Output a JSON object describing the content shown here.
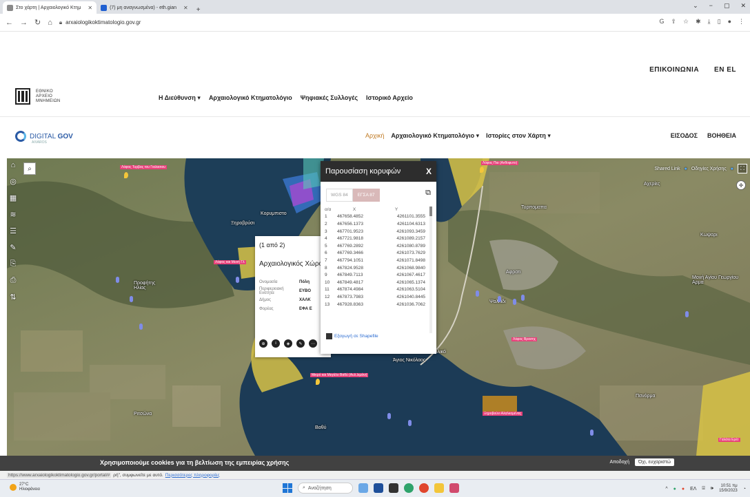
{
  "browser": {
    "tabs": [
      {
        "title": "Στο χάρτη | Αρχαιολογικό Κτημ",
        "active": true,
        "favicon_color": "#8a8a8a"
      },
      {
        "title": "(7) μη αναγνωσμένα) - eth.gian",
        "active": false,
        "favicon_color": "#1f5fd1"
      }
    ],
    "new_tab": "+",
    "url": "arxaiologikoktimatologio.gov.gr",
    "window_controls": [
      "⌄",
      "−",
      "▢",
      "✕"
    ]
  },
  "site": {
    "top_links": [
      "ΕΠΙΚΟΙΝΩΝΙΑ",
      "EN EL"
    ],
    "logo_text": [
      "ΕΘΝΙΚΟ",
      "ΑΡΧΕΙΟ",
      "ΜΝΗΜΕΙΩΝ"
    ],
    "main_nav": [
      "Η Διεύθυνση ▾",
      "Αρχαιολογικό Κτηματολόγιο",
      "Ψηφιακές Συλλογές",
      "Ιστορικό Αρχείο"
    ],
    "dg_logo": {
      "prefix": "DIGITAL ",
      "bold": "GOV",
      "sub": "AIVAROS"
    },
    "sub_nav": {
      "home": "Αρχική",
      "items": [
        "Αρχαιολογικό Κτηματολόγιο ▾",
        "Ιστορίες στον Χάρτη ▾"
      ]
    },
    "login_links": [
      "ΕΙΣΟΔΟΣ",
      "ΒΟΗΘΕΙΑ"
    ]
  },
  "map": {
    "right_controls": {
      "shared_link": "Shared Link",
      "guide": "Οδηγίες Χρήσης"
    },
    "labels": [
      {
        "text": "Κορυμπιστο"
      },
      {
        "text": "Ξηροβρύσι"
      },
      {
        "text": "Προφήτης Ηλίας"
      },
      {
        "text": "Τυρπομαπα"
      },
      {
        "text": "Κωψαρι"
      },
      {
        "text": "Αφρατι"
      },
      {
        "text": "Ψαλλίδι"
      },
      {
        "text": "Βασιλικό"
      },
      {
        "text": "Άγιος Νικόλαος"
      },
      {
        "text": "Μονή Αγίου Γεωργίου Αρμα"
      },
      {
        "text": "Πανόρμα"
      },
      {
        "text": "Ριτσώνα"
      },
      {
        "text": "Βαθύ"
      },
      {
        "text": "Αχερίες"
      }
    ],
    "site_labels": [
      "Λόφος Τυρβας του Γιαλασιου",
      "Λόφος Πια (Ανθοφυτο)",
      "Λόφος και Μυνή Γλ",
      "Λόφος Βρασης",
      "Μικρό και Μεγάλο Βαθύ (Αυλ.λιμάνι)",
      "Ξηροβούνι Αλαλκομένας",
      "Γαλάτα Ερέτ"
    ]
  },
  "feature_popup": {
    "count": "(1 από 2)",
    "title": "Αρχαιολογικός Χώρο",
    "rows": [
      {
        "key": "Ονομασία",
        "value": "Πόλη"
      },
      {
        "key": "Περιφερειακή Ενότητα",
        "value": "ΕΥΒΟ"
      },
      {
        "key": "Δήμος",
        "value": "ΧΑΛΚ"
      },
      {
        "key": "Φορέας",
        "value": "ΕΦΑ Ε"
      }
    ]
  },
  "vertices": {
    "title": "Παρουσίαση κορυφών",
    "close": "X",
    "tabs": [
      "WGS 84",
      "ΕΓΣΑ 87"
    ],
    "selected_tab": 1,
    "columns": [
      "α/α",
      "X",
      "Y"
    ],
    "rows": [
      [
        "1",
        "467658.4852",
        "4261101.3555"
      ],
      [
        "2",
        "467656.1373",
        "4261104.6313"
      ],
      [
        "3",
        "467701.9523",
        "4261093.3459"
      ],
      [
        "4",
        "467721.9818",
        "4261089.2157"
      ],
      [
        "5",
        "467769.2892",
        "4261080.8789"
      ],
      [
        "6",
        "467769.3466",
        "4261073.7629"
      ],
      [
        "7",
        "467794.1051",
        "4261071.8498"
      ],
      [
        "8",
        "467824.9528",
        "4261068.9840"
      ],
      [
        "9",
        "467849.7113",
        "4261067.4617"
      ],
      [
        "10",
        "467849.4817",
        "4261065.1374"
      ],
      [
        "11",
        "467874.4984",
        "4261063.5104"
      ],
      [
        "12",
        "467873.7983",
        "4261040.8445"
      ],
      [
        "13",
        "467928.8363",
        "4261036.7062"
      ]
    ],
    "export_label": "Εξαγωγή σε Shapefile"
  },
  "cookie": {
    "text": "Χρησιμοποιούμε cookies για τη βελτίωση της εμπειρίας χρήσης",
    "accept": "Αποδοχή",
    "decline": "Όχι, ευχαριστώ"
  },
  "status_bar": {
    "url": "https://www.arxaiologikoktimatologio.gov.gr/portal/#",
    "text": "ρή\", συμφωνείτε με αυτό.",
    "link": "Περισσότερες πληροφορίες"
  },
  "taskbar": {
    "temp": "27°C",
    "weather": "Ηλιοφάνεια",
    "search": "Αναζήτηση",
    "lang": "ΕΛ",
    "time": "10:51 πμ",
    "date": "15/9/2023"
  },
  "colors": {
    "dialog_header": "#2d2d2d",
    "selected_tab": "#d9b9b9",
    "link": "#2a6bd1",
    "site_polygon": "#d8c347",
    "site_label": "#e8417a"
  }
}
